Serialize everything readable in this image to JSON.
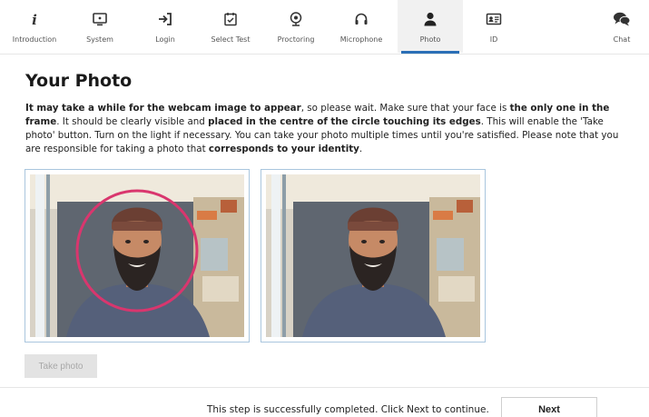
{
  "steps": [
    {
      "label": "Introduction",
      "icon": "info-icon"
    },
    {
      "label": "System",
      "icon": "monitor-icon"
    },
    {
      "label": "Login",
      "icon": "login-icon"
    },
    {
      "label": "Select Test",
      "icon": "calendar-check-icon"
    },
    {
      "label": "Proctoring",
      "icon": "webcam-icon"
    },
    {
      "label": "Microphone",
      "icon": "headset-icon"
    },
    {
      "label": "Photo",
      "icon": "user-icon",
      "active": true
    },
    {
      "label": "ID",
      "icon": "id-card-icon"
    },
    {
      "label": "Chat",
      "icon": "chat-icon"
    }
  ],
  "page": {
    "title": "Your Photo",
    "instructions": {
      "p1_bold": "It may take a while for the webcam image to appear",
      "p2": ", so please wait. Make sure that your face is ",
      "p3_bold": "the only one in the frame",
      "p4": ". It should be clearly visible and ",
      "p5_bold": "placed in the centre of the circle touching its edges",
      "p6": ". This will enable the 'Take photo' button. Turn on the light if necessary. You can take your photo multiple times until you're satisfied. Please note that you are responsible for taking a photo that ",
      "p7_bold": "corresponds to your identity",
      "p8": "."
    },
    "take_photo_label": "Take photo"
  },
  "footer": {
    "status": "This step is successfully completed. Click Next to continue.",
    "next_label": "Next"
  },
  "colors": {
    "accent": "#2a6fb6",
    "circle": "#d9366e",
    "frame_border": "#a9c6de"
  }
}
